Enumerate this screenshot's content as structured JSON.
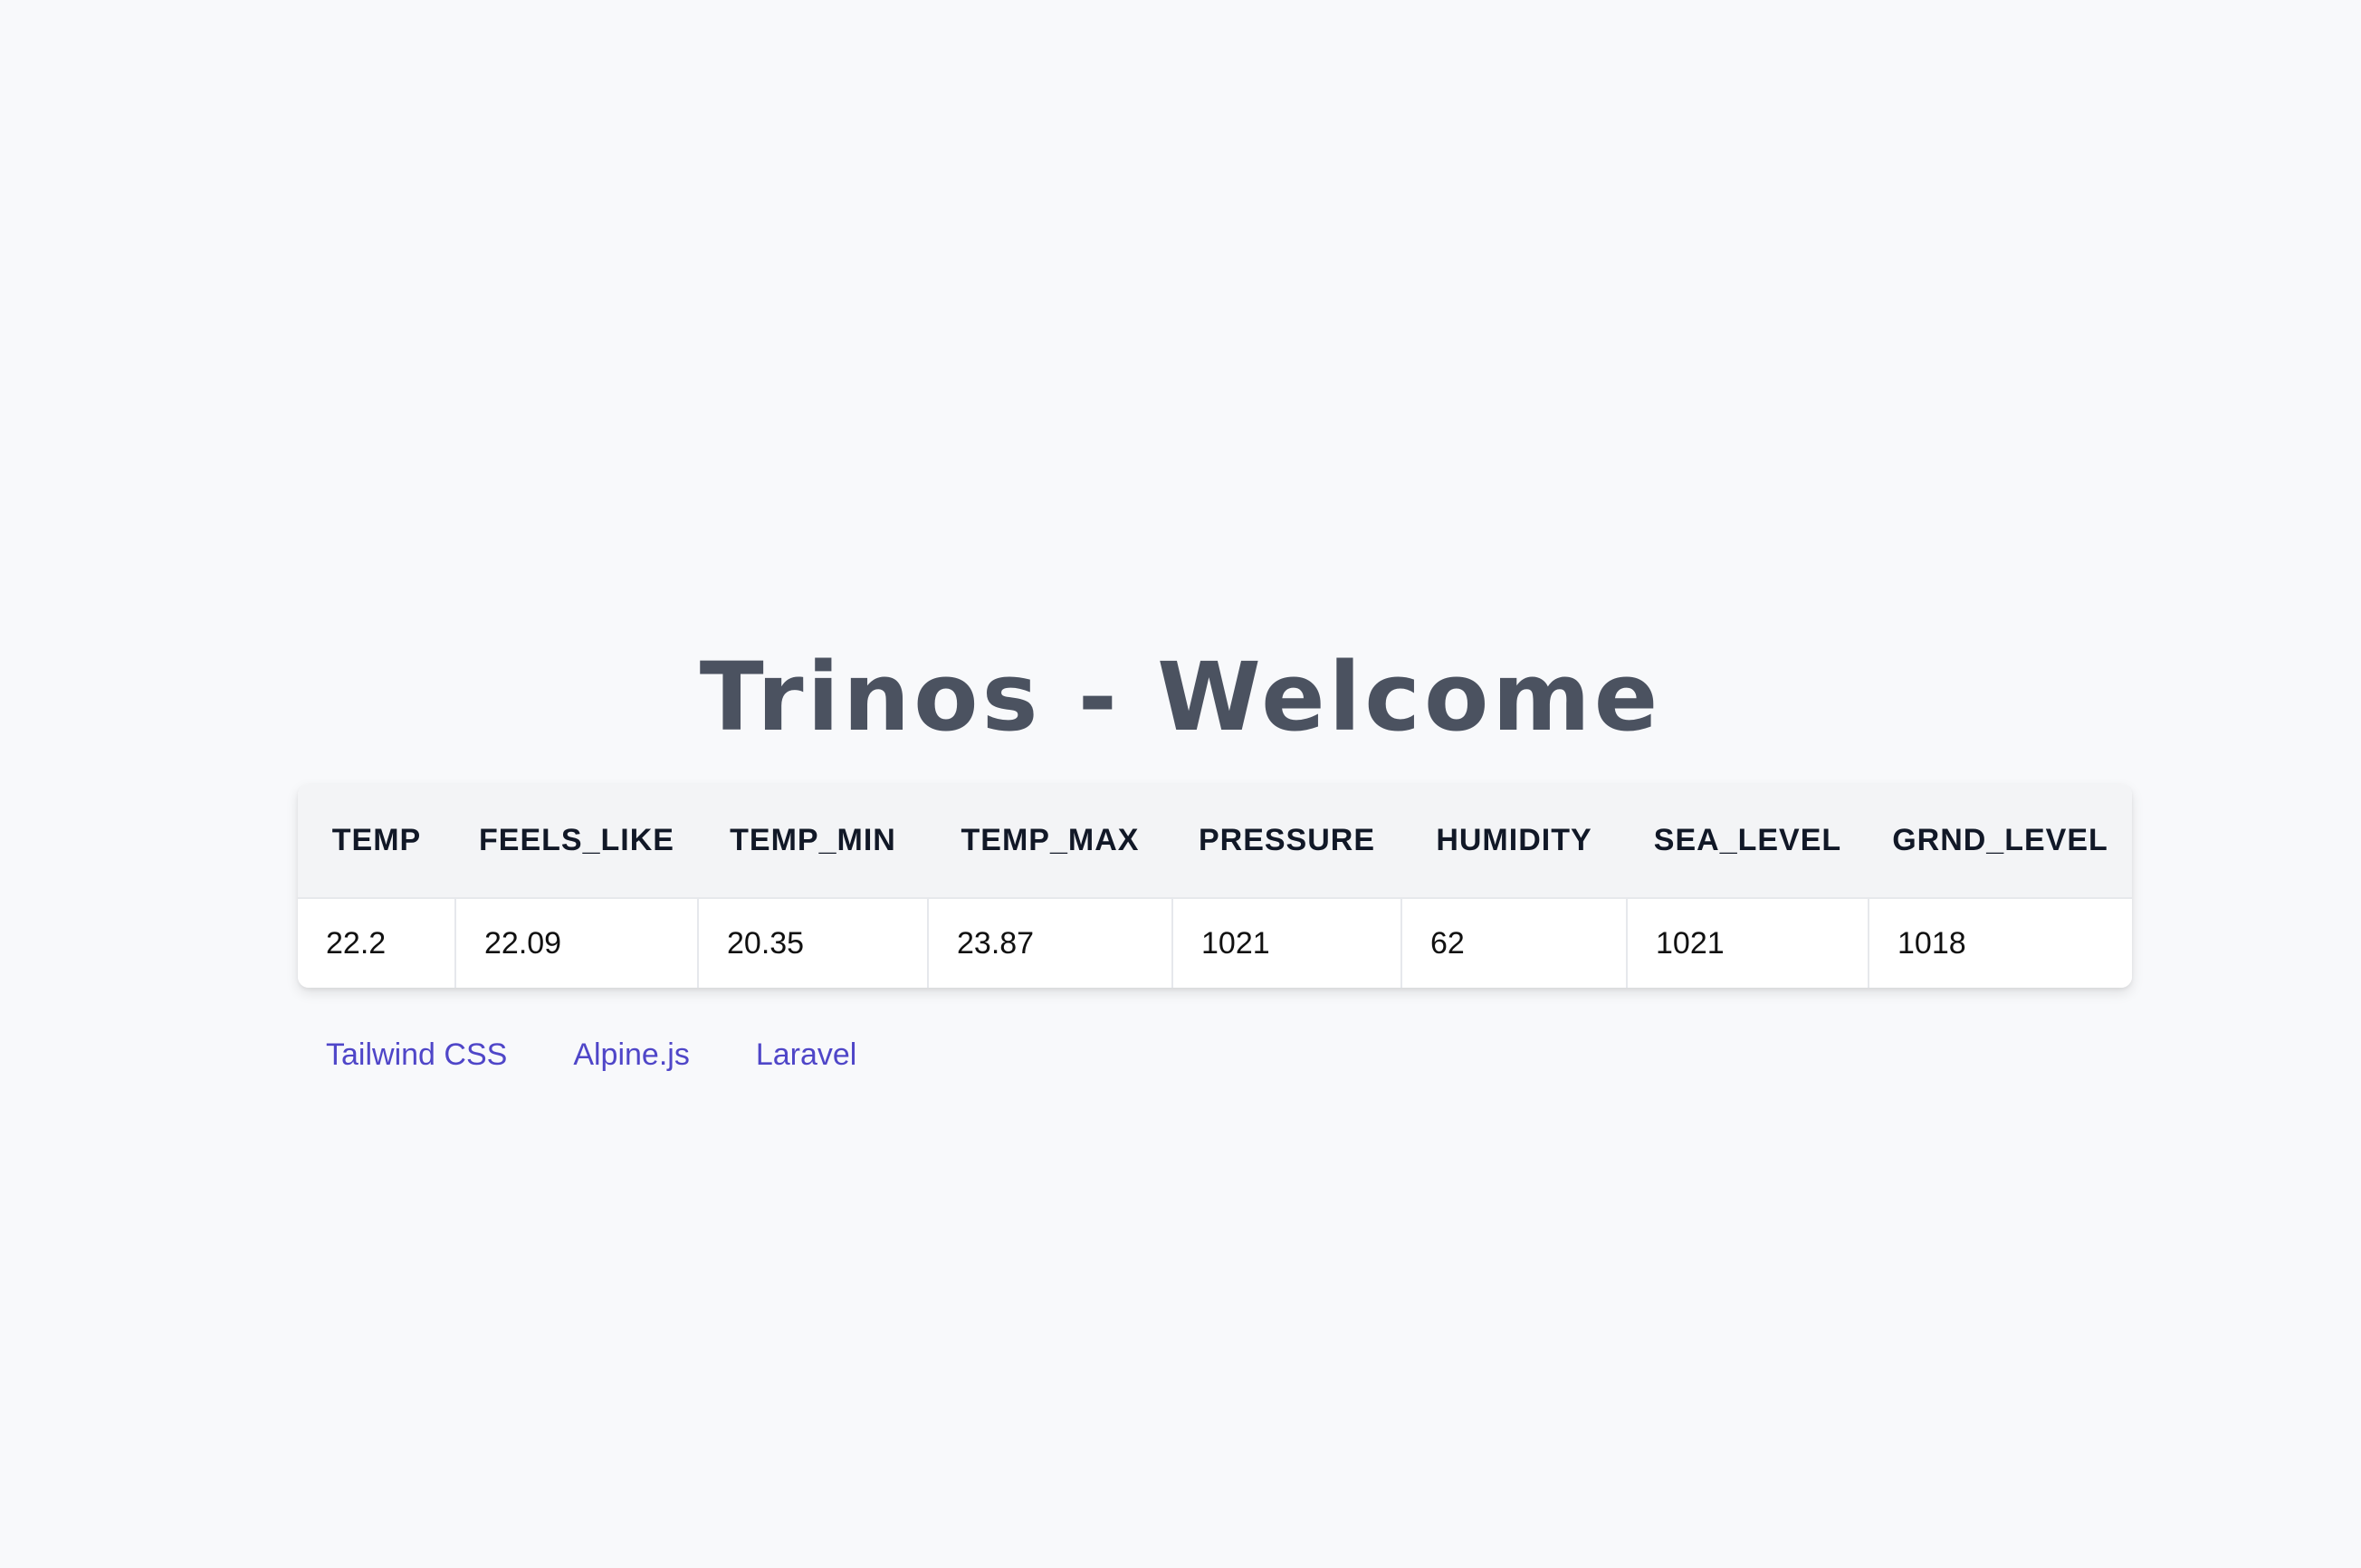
{
  "page": {
    "title": "Trinos - Welcome"
  },
  "weather_table": {
    "headers": [
      "TEMP",
      "FEELS_LIKE",
      "TEMP_MIN",
      "TEMP_MAX",
      "PRESSURE",
      "HUMIDITY",
      "SEA_LEVEL",
      "GRND_LEVEL"
    ],
    "row": [
      "22.2",
      "22.09",
      "20.35",
      "23.87",
      "1021",
      "62",
      "1021",
      "1018"
    ]
  },
  "footer_links": [
    "Tailwind CSS",
    "Alpine.js",
    "Laravel"
  ],
  "colors": {
    "background": "#f8f9fb",
    "title": "#4b5260",
    "header_bg": "#f3f4f6",
    "link": "#4f46c8"
  }
}
